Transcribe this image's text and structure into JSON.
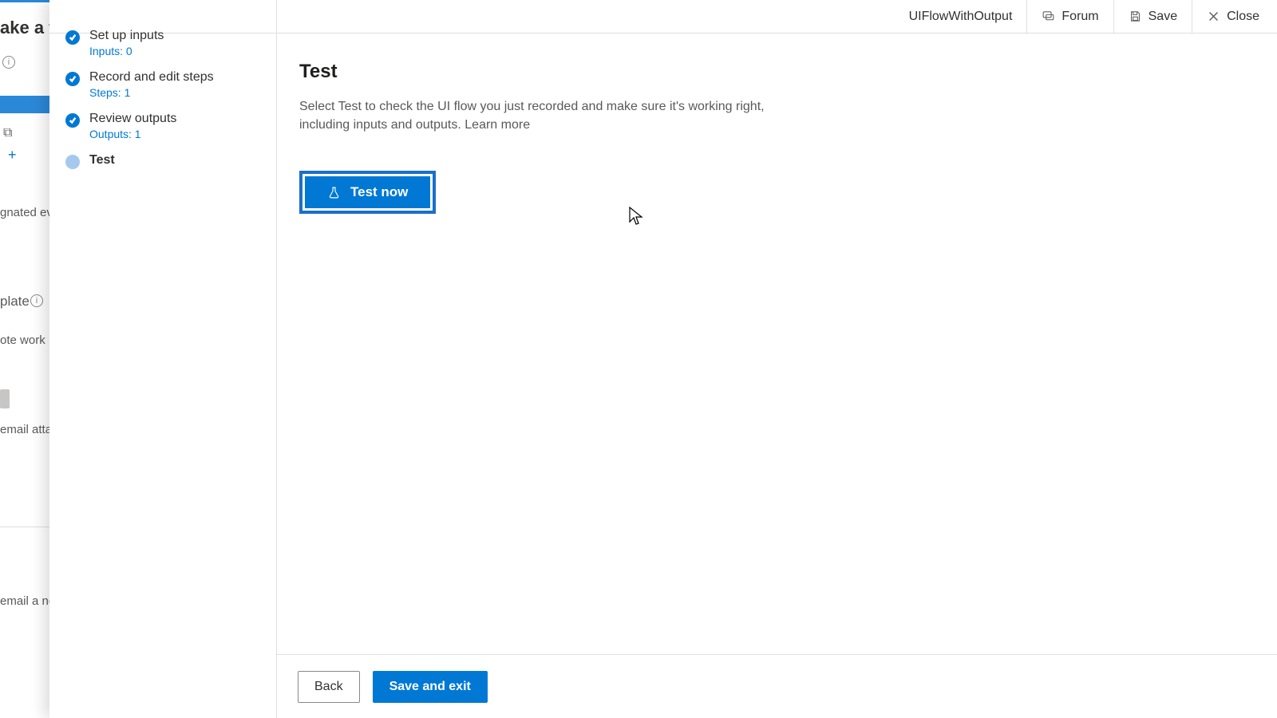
{
  "background": {
    "header": "ake a flo",
    "events_text": "gnated even",
    "template_text": "plate",
    "remote_text": "ote work",
    "attach_text": "email attac",
    "note_text": "email a no"
  },
  "header": {
    "flow_name": "UIFlowWithOutput",
    "forum": "Forum",
    "save": "Save",
    "close": "Close"
  },
  "steps": [
    {
      "title": "Set up inputs",
      "sub": "Inputs: 0",
      "state": "done"
    },
    {
      "title": "Record and edit steps",
      "sub": "Steps: 1",
      "state": "done"
    },
    {
      "title": "Review outputs",
      "sub": "Outputs: 1",
      "state": "done"
    },
    {
      "title": "Test",
      "sub": "",
      "state": "current"
    }
  ],
  "content": {
    "heading": "Test",
    "description": "Select Test to check the UI flow you just recorded and make sure it's working right, including inputs and outputs. ",
    "learn_more": "Learn more",
    "test_now": "Test now"
  },
  "footer": {
    "back": "Back",
    "save_exit": "Save and exit"
  }
}
